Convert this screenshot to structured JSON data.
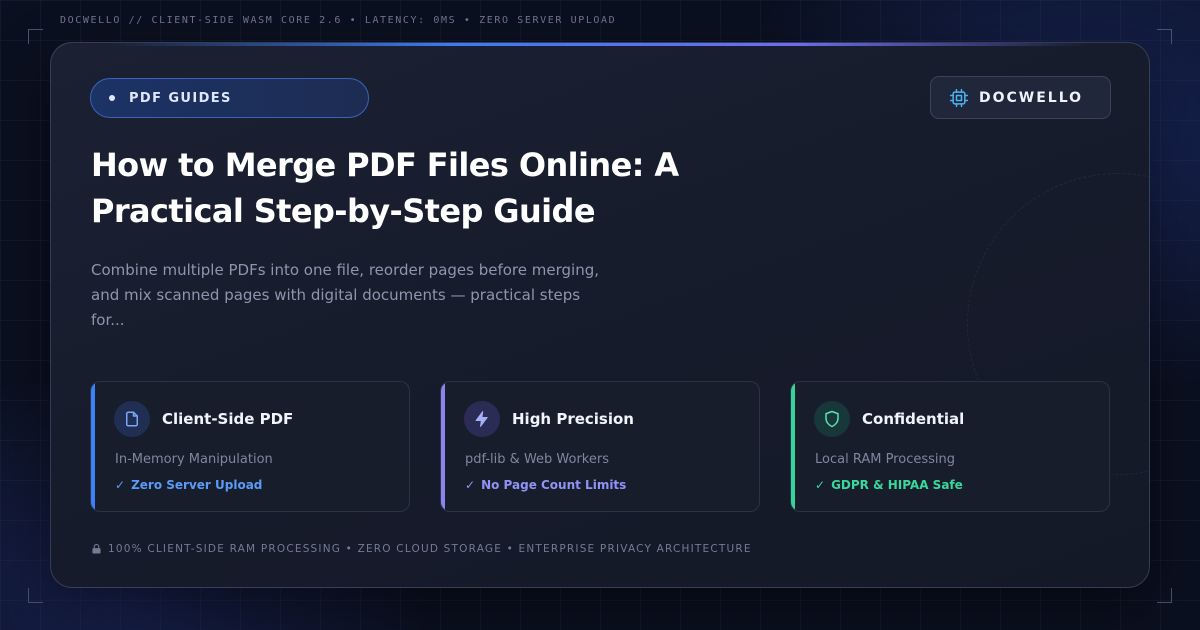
{
  "top_caption": "DOCWELLO // CLIENT-SIDE WASM CORE 2.6 • LATENCY: 0MS • ZERO SERVER UPLOAD",
  "category": {
    "label": "PDF GUIDES"
  },
  "brand": {
    "name": "DOCWELLO",
    "icon": "chip-icon"
  },
  "article": {
    "title": "How to Merge PDF Files Online: A Practical Step-by-Step Guide",
    "description": "Combine multiple PDFs into one file, reorder pages before merging, and mix scanned pages with digital documents — practical steps for..."
  },
  "features": [
    {
      "title": "Client-Side PDF",
      "subtitle": "In-Memory Manipulation",
      "check": "Zero Server Upload",
      "icon": "document-icon",
      "accent": "#3b82f6"
    },
    {
      "title": "High Precision",
      "subtitle": "pdf-lib & Web Workers",
      "check": "No Page Count Limits",
      "icon": "lightning-icon",
      "accent": "#8b84f0"
    },
    {
      "title": "Confidential",
      "subtitle": "Local RAM Processing",
      "check": "GDPR & HIPAA Safe",
      "icon": "shield-icon",
      "accent": "#34d399"
    }
  ],
  "check_mark": "✓",
  "footer": {
    "text": "100% CLIENT-SIDE RAM PROCESSING • ZERO CLOUD STORAGE • ENTERPRISE PRIVACY ARCHITECTURE",
    "icon": "lock-icon"
  }
}
